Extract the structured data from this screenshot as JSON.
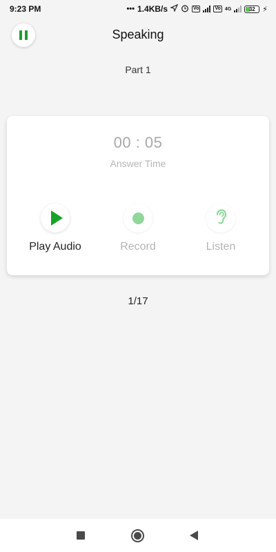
{
  "status_bar": {
    "time": "9:23 PM",
    "net_speed": "1.4KB/s",
    "battery": "32",
    "battery_level": 0.32,
    "icons": [
      "dots-icon",
      "location-arrow-icon",
      "alarm-icon",
      "volte-icon",
      "signal-icon",
      "volte-icon",
      "4g-icon",
      "signal-icon",
      "battery-icon",
      "charging-icon"
    ]
  },
  "header": {
    "title": "Speaking",
    "pause_icon": "pause-icon",
    "accent": "#1e9e2e"
  },
  "part": "Part 1",
  "card": {
    "timer": "00 : 05",
    "timer_label": "Answer Time",
    "actions": [
      {
        "label": "Play Audio",
        "icon": "play-icon",
        "state": "active"
      },
      {
        "label": "Record",
        "icon": "record-icon",
        "state": "disabled"
      },
      {
        "label": "Listen",
        "icon": "ear-icon",
        "state": "disabled"
      }
    ]
  },
  "progress": "1/17",
  "nav_bar": {
    "icons": [
      "recents-icon",
      "home-icon",
      "back-icon"
    ]
  }
}
